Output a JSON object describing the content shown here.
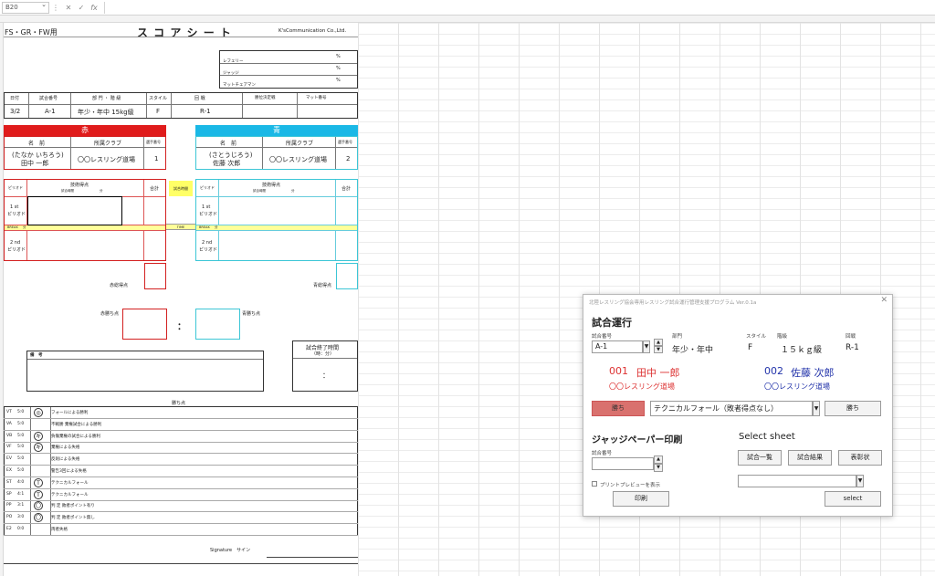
{
  "excel": {
    "name_box": "B20",
    "cancel_icon": "✕",
    "enter_icon": "✓",
    "fx_label": "fx"
  },
  "sheet": {
    "event_label": "FS・GR・FW用",
    "title": "ス コ ア シ ー ト",
    "company": "K'sCommunication Co.,Ltd.",
    "ratio_rows": [
      {
        "label": "レフェリー",
        "unit": "：",
        "pct": "%"
      },
      {
        "label": "ジャッジ",
        "unit": "：",
        "pct": "%"
      },
      {
        "label": "マットチェアマン",
        "unit": "：",
        "pct": "%"
      }
    ],
    "info_headers": [
      "日付",
      "試合番号",
      "部 門 ・ 階 級",
      "スタイル",
      "回 戦",
      "勝位決定戦",
      "マット番号"
    ],
    "info_values": [
      "3/2",
      "A-1",
      "年少・年中 15kg級",
      "F",
      "R-1",
      "",
      ""
    ],
    "red": {
      "header": "赤",
      "name_head": "名　前",
      "club_head": "所属クラブ",
      "no_head": "選手番号",
      "name": "(たなか いちろう)\n田中 一郎",
      "kana": "(たなか いちろう)",
      "kanji": "田中 一郎",
      "club": "〇〇レスリング道場",
      "no": "1"
    },
    "blue": {
      "header": "青",
      "name_head": "名　前",
      "club_head": "所属クラブ",
      "no_head": "選手番号",
      "kana": "(さとうじろう)",
      "kanji": "佐藤 次郎",
      "club": "〇〇レスリング道場",
      "no": "2"
    },
    "score_table": {
      "period_head": "ピリオド",
      "tech_head": "技術得点",
      "tech_sub": "試合時間",
      "tech_sub2": "分",
      "total_head": "合計",
      "match_time_head": "試合時間",
      "time_label": "TIME",
      "period1": "1 st\nピリオド",
      "period1_a": "1 st",
      "period1_b": "ピリオド",
      "period2_a": "2 nd",
      "period2_b": "ピリオド",
      "break_label": "BREAK",
      "break_value": "分"
    },
    "red_total_label": "赤総得点",
    "blue_total_label": "青総得点",
    "red_win_label": "赤勝ち点",
    "blue_win_label": "青勝ち点",
    "colon": "：",
    "remarks_label": "備　考",
    "end_time_label": "試合終了時間",
    "end_time_sub": "（時：分）",
    "end_time_colon": "：",
    "win_points_title": "勝ち点",
    "win_types": [
      {
        "code": "VT",
        "pts": "5:0",
        "mark": "◎",
        "desc": "フォールによる勝利"
      },
      {
        "code": "VA",
        "pts": "5:0",
        "mark": "",
        "desc": "不戦勝 棄権試合による勝利"
      },
      {
        "code": "VB",
        "pts": "5:0",
        "mark": "キ",
        "desc": "負傷棄権の試合による勝利"
      },
      {
        "code": "VF",
        "pts": "5:0",
        "mark": "キ",
        "desc": "棄権による失格"
      },
      {
        "code": "EV",
        "pts": "5:0",
        "mark": "",
        "desc": "反則による失格"
      },
      {
        "code": "EX",
        "pts": "5:0",
        "mark": "",
        "desc": "警告3回による失格"
      },
      {
        "code": "ST",
        "pts": "4:0",
        "mark": "T",
        "desc": "テクニカルフォール"
      },
      {
        "code": "SP",
        "pts": "4:1",
        "mark": "T",
        "desc": "テクニカルフォール"
      },
      {
        "code": "PP",
        "pts": "3:1",
        "mark": "〇",
        "desc": "判 定 敗者ポイント有り"
      },
      {
        "code": "PO",
        "pts": "3:0",
        "mark": "〇",
        "desc": "判 定 敗者ポイント無し"
      },
      {
        "code": "E2",
        "pts": "0:0",
        "mark": "",
        "desc": "両者失格"
      }
    ],
    "st_sub": "敗者ポイント無し",
    "sp_sub": "敗者ポイント有り",
    "signature": "Signature　サイン"
  },
  "dialog": {
    "title": "北陸レスリング協会専用レスリング試合運行管理支援プログラム Ver.0.1a",
    "close": "✕",
    "section_match": "試合運行",
    "match_no_label": "試合番号",
    "match_no": "A-1",
    "division_label": "部門",
    "division": "年少・年中",
    "style_label": "スタイル",
    "style": "F",
    "weight_label": "階級",
    "weight": "１５ｋｇ級",
    "round_label": "回戦",
    "round": "R-1",
    "red_no": "001",
    "red_name": "田中 一郎",
    "red_club": "〇〇レスリング道場",
    "blue_no": "002",
    "blue_name": "佐藤 次郎",
    "blue_club": "〇〇レスリング道場",
    "red_win_btn": "勝ち",
    "result_select": "テクニカルフォール（敗者得点なし）",
    "blue_win_btn": "勝ち",
    "section_judge": "ジャッジペーパー印刷",
    "judge_match_label": "試合番号",
    "preview_label": "プリントプレビューを表示",
    "print_btn": "印刷",
    "section_sheet": "Select sheet",
    "list_btn": "試合一覧",
    "results_btn": "試合結果",
    "award_btn": "表彰状",
    "select_btn": "select",
    "spin_up": "▲",
    "spin_down": "▼",
    "combo_arrow": "▼",
    "colors": {
      "red": "#d33",
      "blue": "#2233aa",
      "red_btn": "#d9716e"
    }
  }
}
